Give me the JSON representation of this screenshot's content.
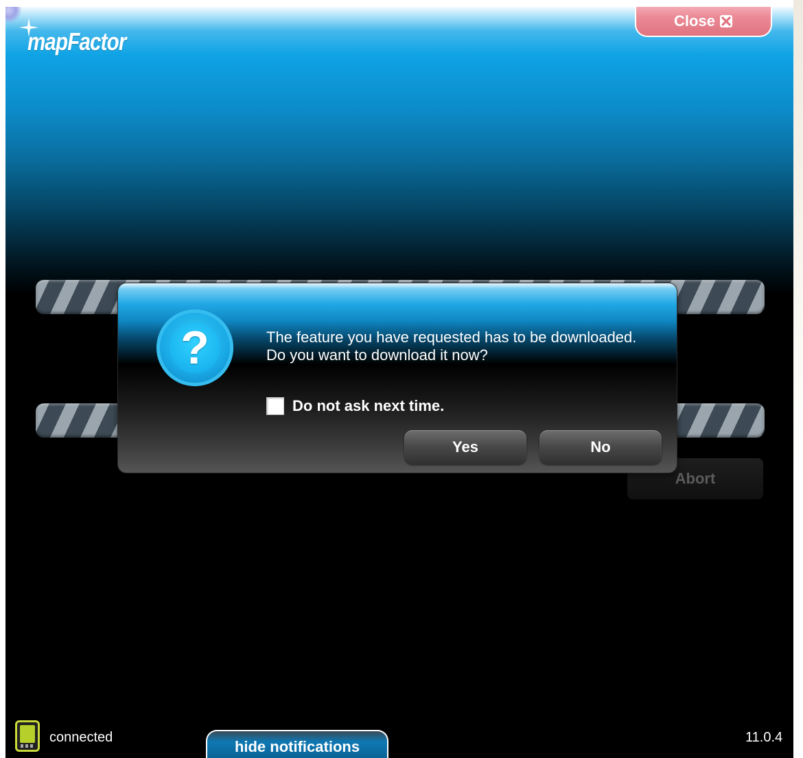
{
  "app": {
    "logo_text": "mapFactor",
    "close_label": "Close",
    "close_icon": "close-x-icon",
    "abort_label": "Abort",
    "accent_color": "#0fa3e5",
    "close_color": "#e07380"
  },
  "dialog": {
    "icon": "question-icon",
    "icon_glyph": "?",
    "message": "The feature you have requested has to be downloaded. Do you want to download it now?",
    "checkbox_label": "Do not ask next time.",
    "checkbox_checked": false,
    "yes_label": "Yes",
    "no_label": "No"
  },
  "status_bar": {
    "device_icon": "device-icon",
    "connection_status": "connected",
    "hide_notifications_label": "hide notifications",
    "version": "11.0.4"
  }
}
